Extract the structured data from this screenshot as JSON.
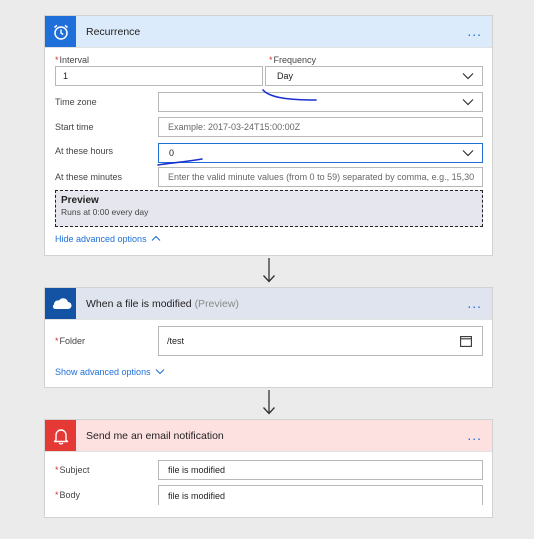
{
  "recurrence": {
    "title": "Recurrence",
    "more": "...",
    "interval": {
      "label": "Interval",
      "value": "1"
    },
    "frequency": {
      "label": "Frequency",
      "value": "Day"
    },
    "timezone": {
      "label": "Time zone",
      "value": ""
    },
    "start_time": {
      "label": "Start time",
      "placeholder": "Example: 2017-03-24T15:00:00Z"
    },
    "at_hours": {
      "label": "At these hours",
      "value": "0"
    },
    "at_minutes": {
      "label": "At these minutes",
      "placeholder": "Enter the valid minute values (from 0 to 59) separated by comma, e.g., 15,30"
    },
    "preview": {
      "title": "Preview",
      "text": "Runs at 0:00 every day"
    },
    "hide_advanced": "Hide advanced options"
  },
  "onedrive": {
    "title": "When a file is modified",
    "title_suffix": "(Preview)",
    "more": "...",
    "folder": {
      "label": "Folder",
      "value": "/test"
    },
    "show_advanced": "Show advanced options"
  },
  "email": {
    "title": "Send me an email notification",
    "more": "...",
    "subject": {
      "label": "Subject",
      "value": "file is modified"
    },
    "body": {
      "label": "Body",
      "value": "file is modified"
    }
  },
  "colors": {
    "recurrence_accent": "#1e6fd9",
    "recurrence_header_bg": "#dcebfc",
    "onedrive_accent": "#1452a3",
    "onedrive_header_bg": "#e0e4ef",
    "email_accent": "#e53935",
    "email_header_bg": "#fde1e1",
    "annotation_ink": "#1a2fd0"
  },
  "icons": [
    "alarm-clock-icon",
    "cloud-icon",
    "bell-icon",
    "chevron-down-icon",
    "chevron-up-icon",
    "folder-picker-icon",
    "arrow-down-icon"
  ]
}
